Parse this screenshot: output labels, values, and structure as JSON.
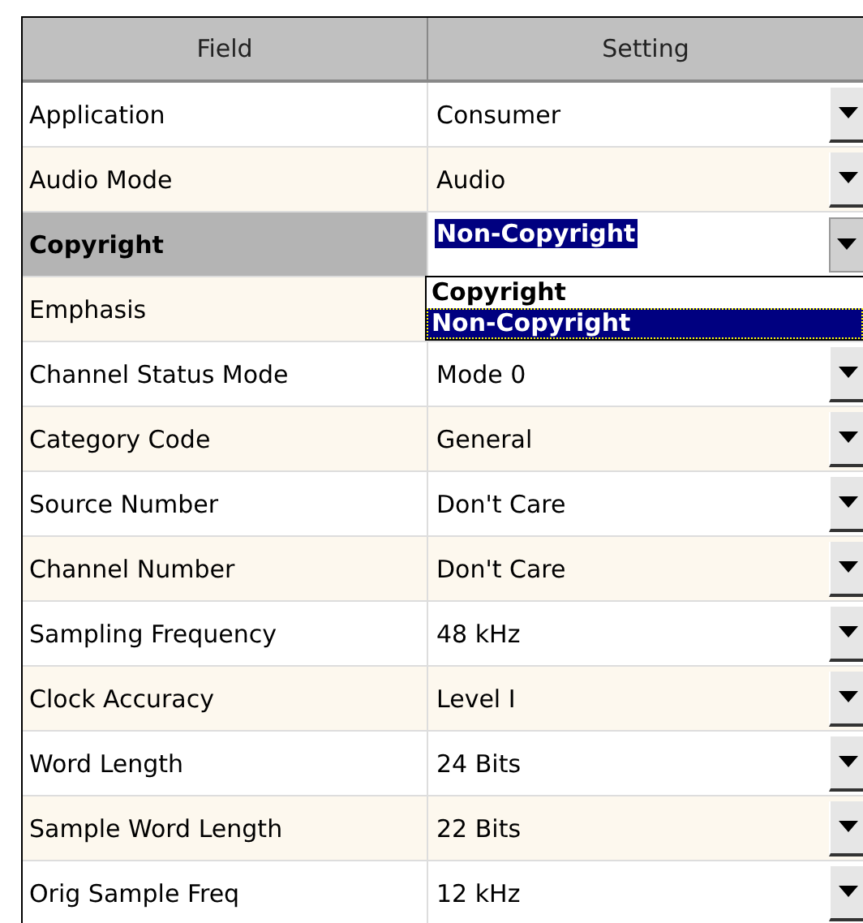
{
  "table": {
    "columns": [
      "Field",
      "Setting"
    ],
    "rows": [
      {
        "field": "Application",
        "setting": "Consumer",
        "selected": false
      },
      {
        "field": "Audio Mode",
        "setting": "Audio",
        "selected": false
      },
      {
        "field": "Copyright",
        "setting": "Non-Copyright",
        "selected": true
      },
      {
        "field": "Emphasis",
        "selected": false
      },
      {
        "field": "Channel Status Mode",
        "setting": "Mode 0",
        "selected": false
      },
      {
        "field": "Category Code",
        "setting": "General",
        "selected": false
      },
      {
        "field": "Source Number",
        "setting": "Don't Care",
        "selected": false
      },
      {
        "field": "Channel Number",
        "setting": "Don't Care",
        "selected": false
      },
      {
        "field": "Sampling Frequency",
        "setting": "48 kHz",
        "selected": false
      },
      {
        "field": "Clock Accuracy",
        "setting": "Level I",
        "selected": false
      },
      {
        "field": "Word Length",
        "setting": "24 Bits",
        "selected": false
      },
      {
        "field": "Sample Word Length",
        "setting": "22 Bits",
        "selected": false
      },
      {
        "field": "Orig Sample Freq",
        "setting": "12 kHz",
        "selected": false
      }
    ]
  },
  "dropdown": {
    "options": [
      {
        "label": "Copyright",
        "selected": false
      },
      {
        "label": "Non-Copyright",
        "selected": true
      }
    ]
  }
}
